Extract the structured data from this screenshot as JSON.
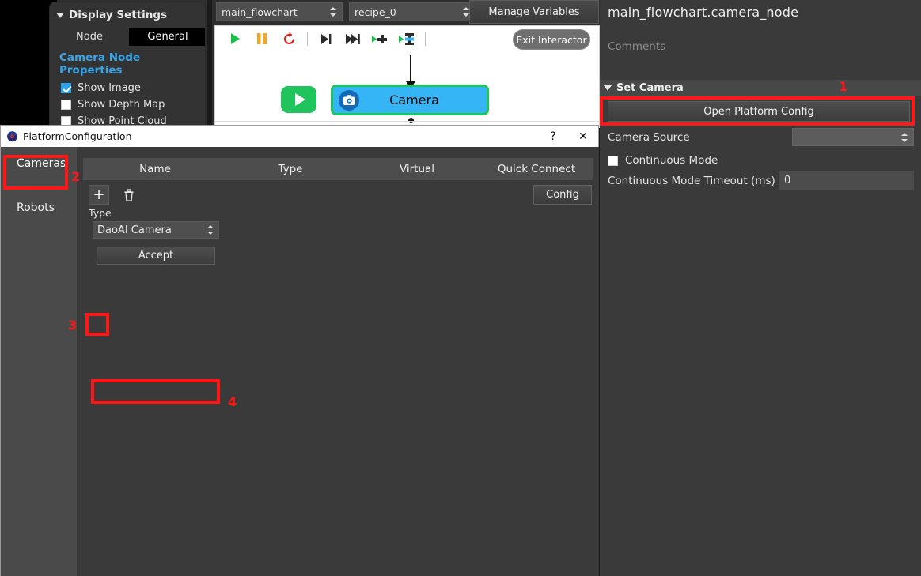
{
  "display_panel": {
    "header": "Display Settings",
    "tabs": [
      {
        "label": "Node",
        "active": false
      },
      {
        "label": "General",
        "active": true
      }
    ],
    "section_title": "Camera Node Properties",
    "checkboxes": [
      {
        "label": "Show Image",
        "checked": true
      },
      {
        "label": "Show Depth Map",
        "checked": false
      },
      {
        "label": "Show Point Cloud",
        "checked": false
      }
    ]
  },
  "topbar": {
    "flowchart_select": "main_flowchart",
    "recipe_select": "recipe_0",
    "manage_variables_label": "Manage Variables"
  },
  "canvas": {
    "toolbar_icons": [
      "play-icon",
      "pause-icon",
      "reset-icon",
      "step-over-icon",
      "step-forward-icon",
      "run-to-node-icon",
      "run-to-breakpoint-icon"
    ],
    "exit_interactor_label": "Exit Interactor",
    "node_label": "Camera",
    "node_icon": "camera-icon",
    "run_icon": "play-icon"
  },
  "right_panel": {
    "title": "main_flowchart.camera_node",
    "comments_placeholder": "Comments",
    "section": {
      "label": "Set Camera",
      "open_platform_config_label": "Open Platform Config",
      "camera_source_label": "Camera Source",
      "camera_source_value": "",
      "continuous_mode_label": "Continuous Mode",
      "continuous_mode_checked": false,
      "continuous_timeout_label": "Continuous Mode Timeout (ms)",
      "continuous_timeout_value": "0"
    }
  },
  "dialog": {
    "title": "PlatformConfiguration",
    "icon": "platform-logo-icon",
    "help_label": "?",
    "close_label": "✕",
    "sidebar_tabs": [
      {
        "label": "Cameras",
        "active": true
      },
      {
        "label": "Robots",
        "active": false
      }
    ],
    "table": {
      "columns": [
        "Name",
        "Type",
        "Virtual",
        "Quick Connect"
      ],
      "rows": []
    },
    "add_label": "+",
    "delete_icon": "trash-icon",
    "type_label": "Type",
    "type_value": "DaoAI Camera",
    "accept_label": "Accept",
    "config_label": "Config"
  },
  "annotations": {
    "steps": [
      "1",
      "2",
      "3",
      "4"
    ],
    "highlight_color": "#ff1717"
  }
}
